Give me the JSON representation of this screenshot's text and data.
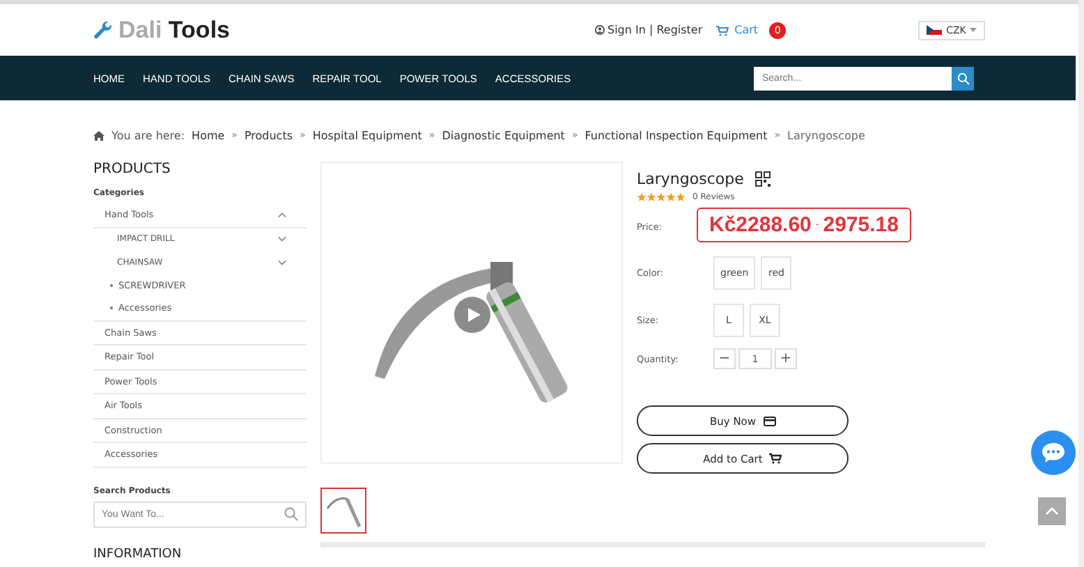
{
  "header": {
    "logo_light": "Dali",
    "logo_dark": "Tools",
    "sign_in": "Sign In | Register",
    "cart": "Cart",
    "cart_count": "0",
    "currency": "CZK"
  },
  "nav": {
    "items": [
      "HOME",
      "HAND TOOLS",
      "CHAIN SAWS",
      "REPAIR TOOL",
      "POWER TOOLS",
      "ACCESSORIES"
    ],
    "search": {
      "placeholder": "Search..."
    }
  },
  "breadcrumb": {
    "label": "You are here:",
    "items": [
      "Home",
      "Products",
      "Hospital Equipment",
      "Diagnostic Equipment",
      "Functional Inspection Equipment",
      "Laryngoscope"
    ],
    "separator": "»"
  },
  "sidebar": {
    "title": "PRODUCTS",
    "categories_label": "Categories",
    "items": [
      {
        "label": "Hand Tools",
        "kind": "toggle",
        "expanded": true,
        "children": [
          {
            "label": "IMPACT DRILL",
            "kind": "toggle",
            "expanded": false
          },
          {
            "label": "CHAINSAW",
            "kind": "toggle",
            "expanded": false
          },
          {
            "label": "SCREWDRIVER",
            "kind": "bullet"
          },
          {
            "label": "Accessories",
            "kind": "bullet"
          }
        ]
      },
      {
        "label": "Chain Saws",
        "kind": "plain"
      },
      {
        "label": "Repair Tool",
        "kind": "plain"
      },
      {
        "label": "Power Tools",
        "kind": "plain"
      },
      {
        "label": "Air Tools",
        "kind": "plain"
      },
      {
        "label": "Construction",
        "kind": "plain"
      },
      {
        "label": "Accessories",
        "kind": "plain"
      }
    ],
    "search_label": "Search Products",
    "search": {
      "placeholder": "You Want To..."
    },
    "info_title": "INFORMATION"
  },
  "product": {
    "title": "Laryngoscope",
    "stars": 5,
    "reviews": "0 Reviews",
    "price_label": "Price:",
    "price_low": "Kč2288.60",
    "price_sep": "-",
    "price_high": "2975.18",
    "options": [
      {
        "label": "Color:",
        "values": [
          "green",
          "red"
        ]
      },
      {
        "label": "Size:",
        "values": [
          "L",
          "XL"
        ]
      }
    ],
    "quantity_label": "Quantity:",
    "quantity": "1",
    "minus": "−",
    "plus": "+",
    "buy_now": "Buy Now",
    "add_to_cart": "Add to Cart"
  }
}
